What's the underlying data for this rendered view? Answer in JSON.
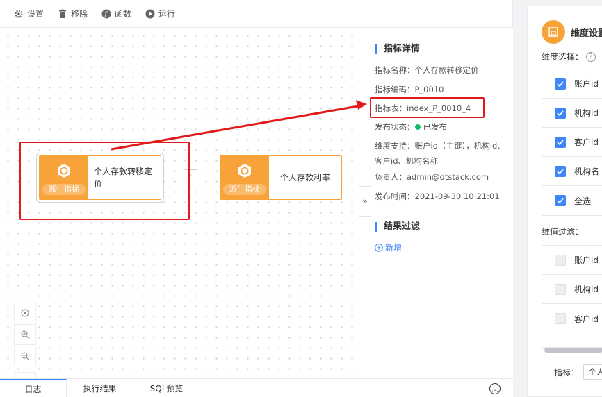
{
  "toolbar": {
    "items": [
      {
        "label": "设置",
        "icon": "gear-icon"
      },
      {
        "label": "移除",
        "icon": "trash-icon"
      },
      {
        "label": "函数",
        "icon": "function-icon"
      },
      {
        "label": "运行",
        "icon": "play-icon"
      }
    ]
  },
  "canvas": {
    "nodes": [
      {
        "tag": "派生指标",
        "title": "个人存款转移定价"
      },
      {
        "tag": "派生指标",
        "title": "个人存款利率"
      }
    ],
    "connector_label": "-"
  },
  "detail": {
    "title": "指标详情",
    "rows": {
      "name": "指标名称：个人存款转移定价",
      "code": "指标编码：P_0010",
      "table": "指标表：index_P_0010_4",
      "status_label": "发布状态：",
      "status_value": "已发布",
      "dimension": "维度支持：账户id（主键），机构id、客户id、机构名称",
      "owner": "负责人：admin@dtstack.com",
      "time": "发布时间：2021-09-30 10:21:01"
    },
    "filter_title": "结果过滤",
    "add_label": "新增",
    "collapse_icon": "»"
  },
  "bottom_tabs": [
    "日志",
    "执行结果",
    "SQL预览"
  ],
  "right_panel": {
    "title": "维度设置",
    "dim_select_label": "维度选择：",
    "dim_items": [
      "账户id",
      "机构id",
      "客户id",
      "机构名",
      "全选"
    ],
    "value_filter_label": "维值过滤：",
    "value_items": [
      "账户id",
      "机构id",
      "客户id"
    ],
    "filter_label": "指标：",
    "filter_value": "个人"
  },
  "colors": {
    "accent": "#3f87f5",
    "node": "#f7a33a",
    "highlight": "#e31a1a",
    "published": "#12bc6a"
  }
}
